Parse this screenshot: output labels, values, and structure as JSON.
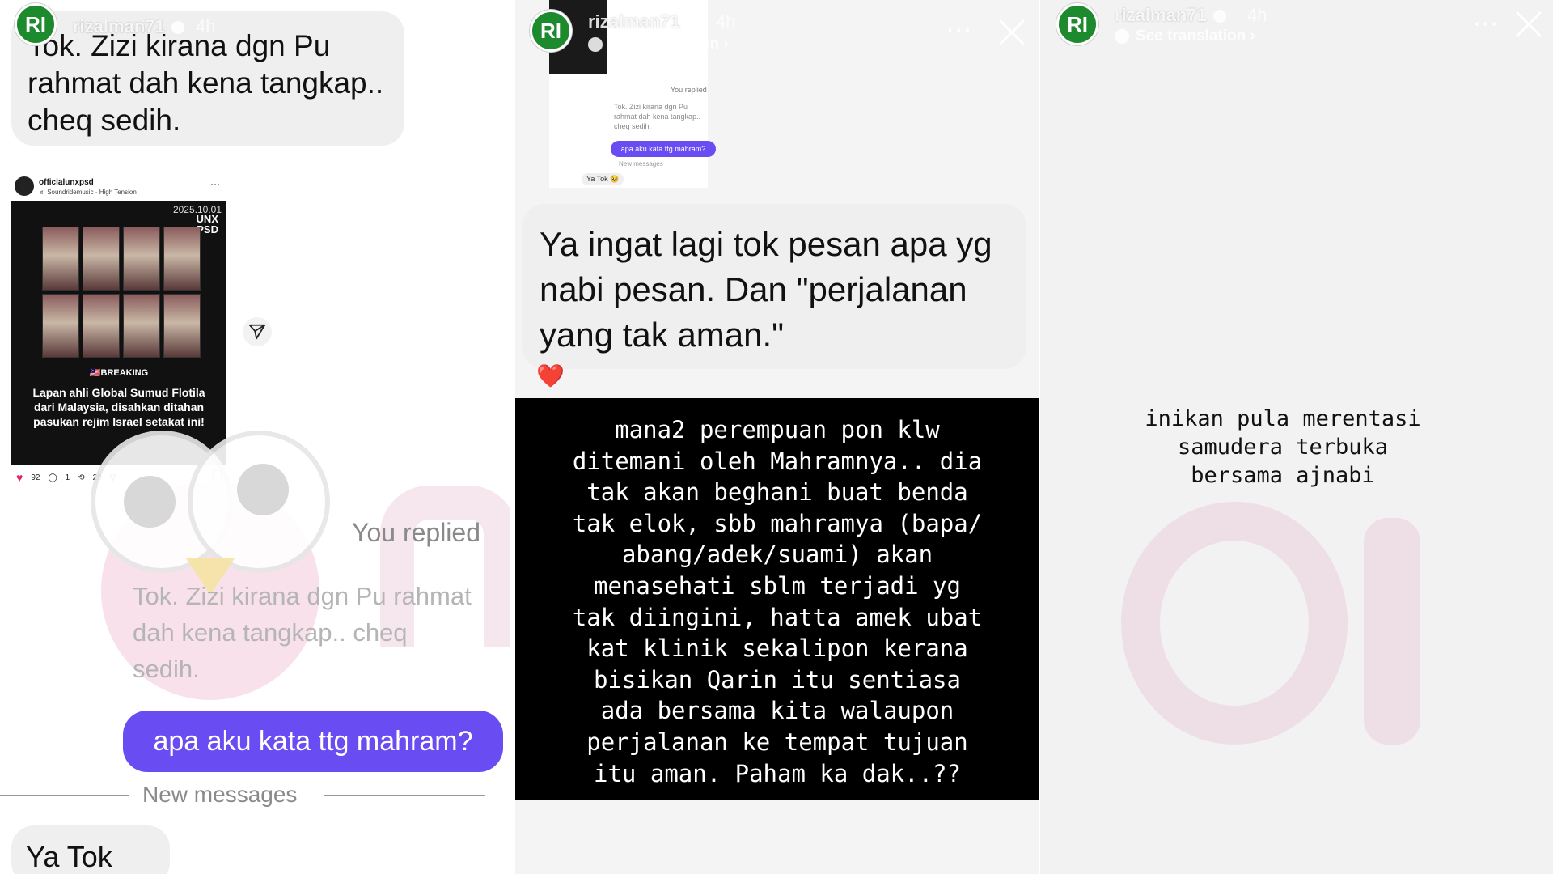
{
  "stories": [
    {
      "username": "rizalman71",
      "avatar_initials": "RI",
      "time_ago": "4h",
      "more_label": "···",
      "bubble_text": "Tok. Zizi kirana dgn Pu rahmat dah kena tangkap.. cheq sedih.",
      "shared_post": {
        "account": "officialunxpsd",
        "audio": "♬ Soundridemusic · High Tension",
        "date": "2025.10.01",
        "brand": "UNX PSD",
        "tag": "🇲🇾BREAKING",
        "caption": "Lapan ahli Global Sumud Flotila dari Malaysia, disahkan ditahan pasukan rejim Israel setakat ini!",
        "likes": "92",
        "comments": "1",
        "reposts": "29"
      },
      "you_replied": "You replied",
      "quoted_text": "Tok. Zizi kirana dgn Pu rahmat dah kena tangkap.. cheq sedih.",
      "reply_text": "apa aku kata ttg mahram?",
      "new_messages": "New messages",
      "last_message": "Ya Tok 🥺"
    },
    {
      "username": "rizalman71",
      "avatar_initials": "RI",
      "time_ago": "4h",
      "see_translation": "See translation ›",
      "more_label": "···",
      "thumb": {
        "you_replied": "You replied",
        "quote": "Tok. Zizi kirana dgn Pu rahmat dah kena tangkap.. cheq sedih.",
        "reply": "apa aku kata ttg mahram?",
        "new_messages": "New messages",
        "last": "Ya Tok 🥺"
      },
      "bubble_text": "Ya ingat lagi tok pesan apa yg nabi pesan. Dan \"perjalanan yang tak aman.\"",
      "reaction": "❤️",
      "caption": "mana2 perempuan pon klw\nditemani oleh Mahramnya.. dia\ntak akan beghani buat benda\ntak elok, sbb mahramya (bapa/\nabang/adek/suami) akan\nmenasehati sblm terjadi yg\ntak diingini, hatta amek ubat\nkat klinik sekalipon kerana\nbisikan Qarin itu sentiasa\nada bersama kita walaupon\nperjalanan ke tempat tujuan\nitu aman. Paham ka dak..??"
    },
    {
      "username": "rizalman71",
      "avatar_initials": "RI",
      "time_ago": "4h",
      "see_translation": "See translation ›",
      "more_label": "···",
      "caption": "inikan pula merentasi\nsamudera terbuka\nbersama ajnabi"
    }
  ],
  "colors": {
    "reply_bubble": "#6a4cf3",
    "avatar_green": "#1e8a2e",
    "heart": "#e0245e"
  },
  "icons": [
    "close-icon",
    "more-icon",
    "verified-icon",
    "share-icon",
    "heart-icon",
    "comment-icon",
    "repost-icon",
    "bookmark-icon",
    "translate-icon"
  ]
}
